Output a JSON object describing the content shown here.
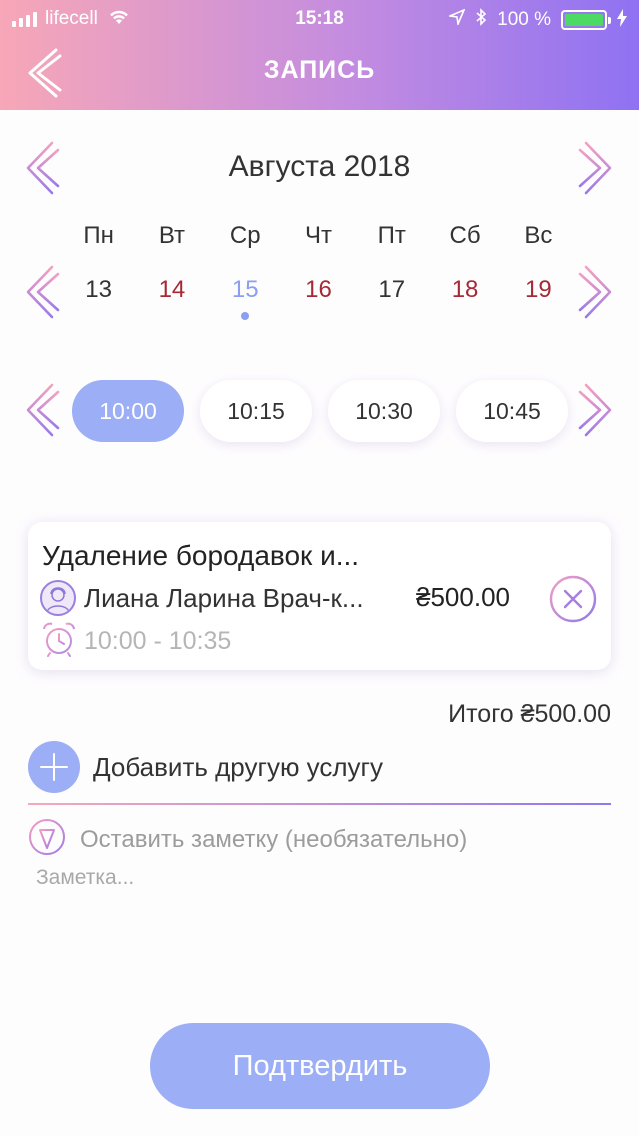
{
  "status_bar": {
    "carrier": "lifecell",
    "time": "15:18",
    "battery": "100 %",
    "battery_level": 1.0
  },
  "header": {
    "title": "ЗАПИСЬ"
  },
  "calendar": {
    "month": "Августа 2018",
    "weekdays": [
      "Пн",
      "Вт",
      "Ср",
      "Чт",
      "Пт",
      "Сб",
      "Вс"
    ],
    "dates": [
      "13",
      "14",
      "15",
      "16",
      "17",
      "18",
      "19"
    ],
    "selected_date": "15",
    "colors": {
      "normal": "#333333",
      "busy": "#a52a35",
      "selected": "#8b9ff0"
    }
  },
  "time_slots": {
    "items": [
      "10:00",
      "10:15",
      "10:30",
      "10:45"
    ],
    "selected": "10:00"
  },
  "booking": {
    "service": "Удаление бородавок и...",
    "doctor": "Лиана Ларина Врач-к...",
    "price": "₴500.00",
    "time_range": "10:00 - 10:35"
  },
  "total": {
    "label": "Итого ₴500.00"
  },
  "add_service": {
    "label": "Добавить другую услугу"
  },
  "note": {
    "label": "Оставить заметку (необязательно)",
    "placeholder": "Заметка..."
  },
  "confirm_button": {
    "label": "Подтвердить"
  },
  "accent": {
    "blue": "#9caef5",
    "pink": "#f5a9ba",
    "purple": "#8f72f2"
  }
}
